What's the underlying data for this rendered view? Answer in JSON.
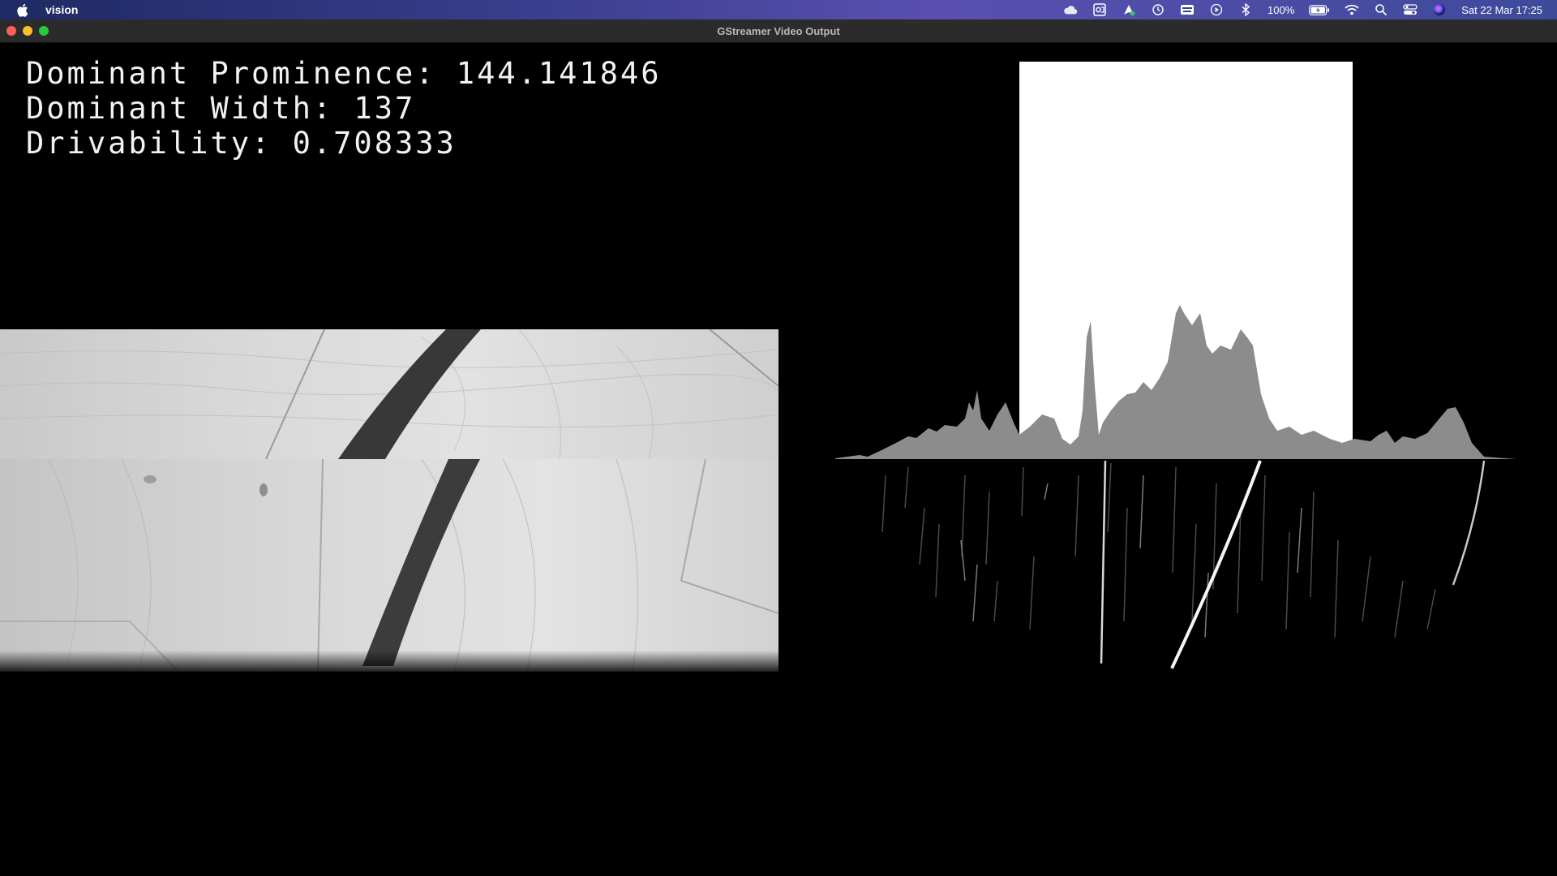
{
  "menubar": {
    "app_name": "vision",
    "battery_text": "100%",
    "datetime": "Sat 22 Mar  17:25",
    "icons": [
      "apple-icon",
      "icloud-icon",
      "outlook-icon",
      "vpn-icon",
      "time-machine-icon",
      "keyboard-icon",
      "play-icon",
      "bluetooth-icon",
      "battery-icon",
      "wifi-icon",
      "spotlight-icon",
      "control-center-icon",
      "siri-icon"
    ]
  },
  "window": {
    "title": "GStreamer Video Output"
  },
  "overlay": {
    "prominence": "Dominant Prominence: 144.141846",
    "width": "Dominant Width: 137",
    "drivability": "Drivability: 0.708333"
  },
  "colors": {
    "background": "#000000",
    "histogram_fill": "#8c8c8c",
    "dominant_band": "#ffffff",
    "overlay_text": "#f2f2f2"
  }
}
